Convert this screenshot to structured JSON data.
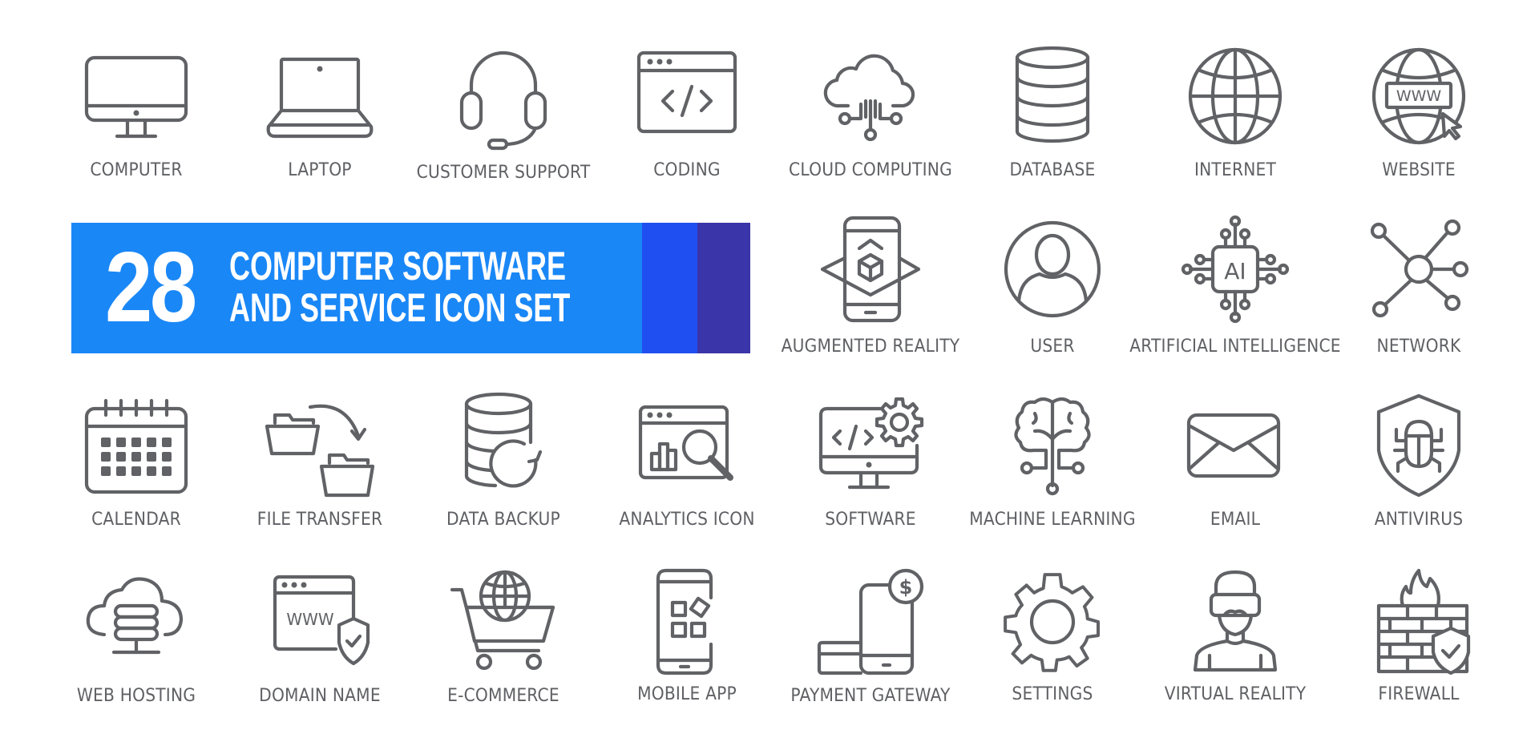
{
  "banner": {
    "count": "28",
    "title_line1": "COMPUTER SOFTWARE",
    "title_line2": "AND SERVICE ICON SET",
    "colors": {
      "primary": "#1a87f6",
      "accent": "#1f4ff0",
      "dark": "#3a35a8"
    }
  },
  "icon_color": "#616266",
  "icons": [
    {
      "label": "COMPUTER",
      "icon": "computer-icon"
    },
    {
      "label": "LAPTOP",
      "icon": "laptop-icon"
    },
    {
      "label": "CUSTOMER SUPPORT",
      "icon": "headset-icon"
    },
    {
      "label": "CODING",
      "icon": "code-window-icon"
    },
    {
      "label": "CLOUD COMPUTING",
      "icon": "cloud-network-icon"
    },
    {
      "label": "DATABASE",
      "icon": "database-icon"
    },
    {
      "label": "INTERNET",
      "icon": "globe-icon"
    },
    {
      "label": "WEBSITE",
      "icon": "globe-www-icon",
      "text": "WWW"
    },
    {
      "label": "AUGMENTED REALITY",
      "icon": "phone-ar-cube-icon"
    },
    {
      "label": "USER",
      "icon": "user-circle-icon"
    },
    {
      "label": "ARTIFICIAL INTELLIGENCE",
      "icon": "ai-chip-icon",
      "text": "AI"
    },
    {
      "label": "NETWORK",
      "icon": "network-nodes-icon"
    },
    {
      "label": "CALENDAR",
      "icon": "calendar-icon"
    },
    {
      "label": "FILE TRANSFER",
      "icon": "folder-transfer-icon"
    },
    {
      "label": "DATA BACKUP",
      "icon": "database-refresh-icon"
    },
    {
      "label": "ANALYTICS ICON",
      "icon": "analytics-search-icon"
    },
    {
      "label": "SOFTWARE",
      "icon": "monitor-code-gear-icon"
    },
    {
      "label": "MACHINE LEARNING",
      "icon": "brain-circuit-icon"
    },
    {
      "label": "EMAIL",
      "icon": "envelope-icon"
    },
    {
      "label": "ANTIVIRUS",
      "icon": "shield-bug-icon"
    },
    {
      "label": "WEB HOSTING",
      "icon": "cloud-server-icon"
    },
    {
      "label": "DOMAIN NAME",
      "icon": "browser-www-shield-icon",
      "text": "WWW"
    },
    {
      "label": "E-COMMERCE",
      "icon": "cart-globe-icon"
    },
    {
      "label": "MOBILE APP",
      "icon": "phone-apps-icon"
    },
    {
      "label": "PAYMENT GATEWAY",
      "icon": "phone-card-dollar-icon",
      "text": "$"
    },
    {
      "label": "SETTINGS",
      "icon": "gear-icon"
    },
    {
      "label": "VIRTUAL REALITY",
      "icon": "vr-headset-person-icon"
    },
    {
      "label": "FIREWALL",
      "icon": "firewall-shield-icon"
    }
  ]
}
